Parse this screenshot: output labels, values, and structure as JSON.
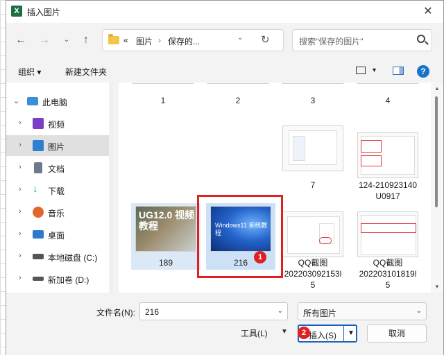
{
  "window": {
    "title": "插入图片",
    "app_icon_letter": "X"
  },
  "address": {
    "chevrons": "«",
    "crumbs": [
      "图片",
      "保存的..."
    ],
    "separator": "›"
  },
  "search": {
    "placeholder": "搜索\"保存的图片\""
  },
  "commands": {
    "organize": "组织 ▾",
    "new_folder": "新建文件夹",
    "help": "?"
  },
  "sidebar": {
    "items": [
      {
        "label": "此电脑",
        "expanded": true,
        "icon": "monitor-icon",
        "color": "#3a8fd8"
      },
      {
        "label": "视频",
        "icon": "video-icon",
        "color": "#7b3fc4"
      },
      {
        "label": "图片",
        "icon": "pictures-icon",
        "color": "#2e7fd0",
        "selected": true
      },
      {
        "label": "文档",
        "icon": "document-icon",
        "color": "#6b7a8f"
      },
      {
        "label": "下载",
        "icon": "download-icon",
        "color": "#1a9a6a"
      },
      {
        "label": "音乐",
        "icon": "music-icon",
        "color": "#e0672c"
      },
      {
        "label": "桌面",
        "icon": "desktop-icon",
        "color": "#2f79c9"
      },
      {
        "label": "本地磁盘 (C:)",
        "icon": "drive-c-icon",
        "color": "#555555"
      },
      {
        "label": "新加卷 (D:)",
        "icon": "drive-d-icon",
        "color": "#555555"
      }
    ]
  },
  "files": [
    {
      "name": "1"
    },
    {
      "name": "2"
    },
    {
      "name": "3"
    },
    {
      "name": "4"
    },
    {
      "name": "7"
    },
    {
      "name": "124-210923140U0917"
    },
    {
      "name": "189",
      "thumb_text": "UG12.0 视频教程"
    },
    {
      "name": "216",
      "thumb_text": "Windows11 系统教程",
      "selected": true
    },
    {
      "name": "QQ截图202203092153l5"
    },
    {
      "name": "QQ截图202203101819l5"
    }
  ],
  "file_labels": {
    "f124_line1": "124-210923140",
    "f124_line2": "U0917",
    "qq1_line1": "QQ截图",
    "qq1_line2": "202203092153l",
    "qq1_line3": "5",
    "qq2_line1": "QQ截图",
    "qq2_line2": "202203101819l",
    "qq2_line3": "5"
  },
  "bottom": {
    "filename_label": "文件名(N):",
    "filename_value": "216",
    "filter_value": "所有图片",
    "tools_label": "工具(L)",
    "insert_label": "插入(S)",
    "cancel_label": "取消"
  },
  "annotations": {
    "badge1": "1",
    "badge2": "2"
  },
  "colors": {
    "highlight": "#e02020",
    "selection": "#cce1f7",
    "accent": "#1a64b8"
  }
}
